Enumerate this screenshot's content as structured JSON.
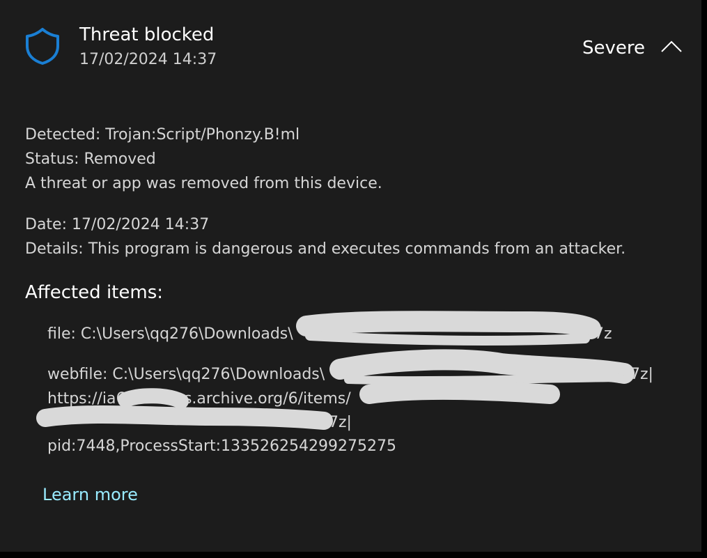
{
  "header": {
    "title": "Threat blocked",
    "timestamp": "17/02/2024 14:37",
    "severity": "Severe",
    "shield_icon": "shield-icon",
    "collapse_icon": "chevron-up-icon"
  },
  "summary": {
    "detected_label": "Detected:",
    "detected_value": "Trojan:Script/Phonzy.B!ml",
    "status_label": "Status:",
    "status_value": "Removed",
    "status_message": "A threat or app was removed from this device.",
    "date_label": "Date:",
    "date_value": "17/02/2024 14:37",
    "details_label": "Details:",
    "details_value": "This program is dangerous and executes commands from an attacker."
  },
  "affected": {
    "heading": "Affected items:",
    "file_line": "file: C:\\Users\\qq276\\Downloads\\",
    "file_suffix": ".7z",
    "webfile_line": "webfile: C:\\Users\\qq276\\Downloads\\",
    "webfile_suffix": ".7z|",
    "url_start": "https://ia6",
    "url_middle": "us.archive.org/6/items/",
    "url_end_suffix": ".7z|",
    "pid_line": "pid:7448,ProcessStart:133526254299275275"
  },
  "links": {
    "learn_more": "Learn more"
  },
  "colors": {
    "background": "#1c1c1c",
    "shield": "#1a7fd4",
    "link": "#99ebff",
    "redaction": "#d9d9d9"
  }
}
